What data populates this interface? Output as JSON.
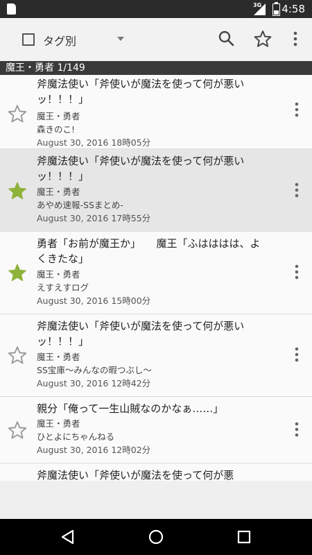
{
  "status_bar": {
    "time": "4:58",
    "network": "3G",
    "icons": [
      "sd-card-icon",
      "signal-icon",
      "battery-icon"
    ]
  },
  "app_bar": {
    "filter_label": "タグ別",
    "actions": [
      "search-icon",
      "star-outline-icon",
      "more-vert-icon"
    ]
  },
  "section_header": "魔王・勇者 1/149",
  "items": [
    {
      "title": "斧魔法使い「斧使いが魔法を使って何が悪いッ！！！」",
      "tag": "魔王・勇者",
      "source": "森きのこ!",
      "date": "August 30, 2016 18時05分",
      "starred": false,
      "selected": false
    },
    {
      "title": "斧魔法使い「斧使いが魔法を使って何が悪いッ！！！」",
      "tag": "魔王・勇者",
      "source": "あやめ速報-SSまとめ-",
      "date": "August 30, 2016 17時55分",
      "starred": true,
      "selected": true
    },
    {
      "title": "勇者「お前が魔王か」　　魔王「ふはははは、よくきたな」",
      "tag": "魔王・勇者",
      "source": "えすえすログ",
      "date": "August 30, 2016 15時00分",
      "starred": true,
      "selected": false
    },
    {
      "title": "斧魔法使い「斧使いが魔法を使って何が悪いッ！！！」",
      "tag": "魔王・勇者",
      "source": "SS宝庫～みんなの暇つぶし～",
      "date": "August 30, 2016 12時42分",
      "starred": false,
      "selected": false
    },
    {
      "title": "親分「俺って一生山賊なのかなぁ……」",
      "tag": "魔王・勇者",
      "source": "ひとよにちゃんねる",
      "date": "August 30, 2016 12時02分",
      "starred": false,
      "selected": false
    },
    {
      "title": "斧魔法使い「斧使いが魔法を使って何が悪",
      "partial": true
    }
  ],
  "colors": {
    "star_filled": "#8fb23b",
    "star_outline": "#9a9a9a",
    "section_bg": "#3a3a3a",
    "selected_bg": "#e6e6e6"
  },
  "nav_bar": [
    "back-icon",
    "home-icon",
    "recents-icon"
  ]
}
